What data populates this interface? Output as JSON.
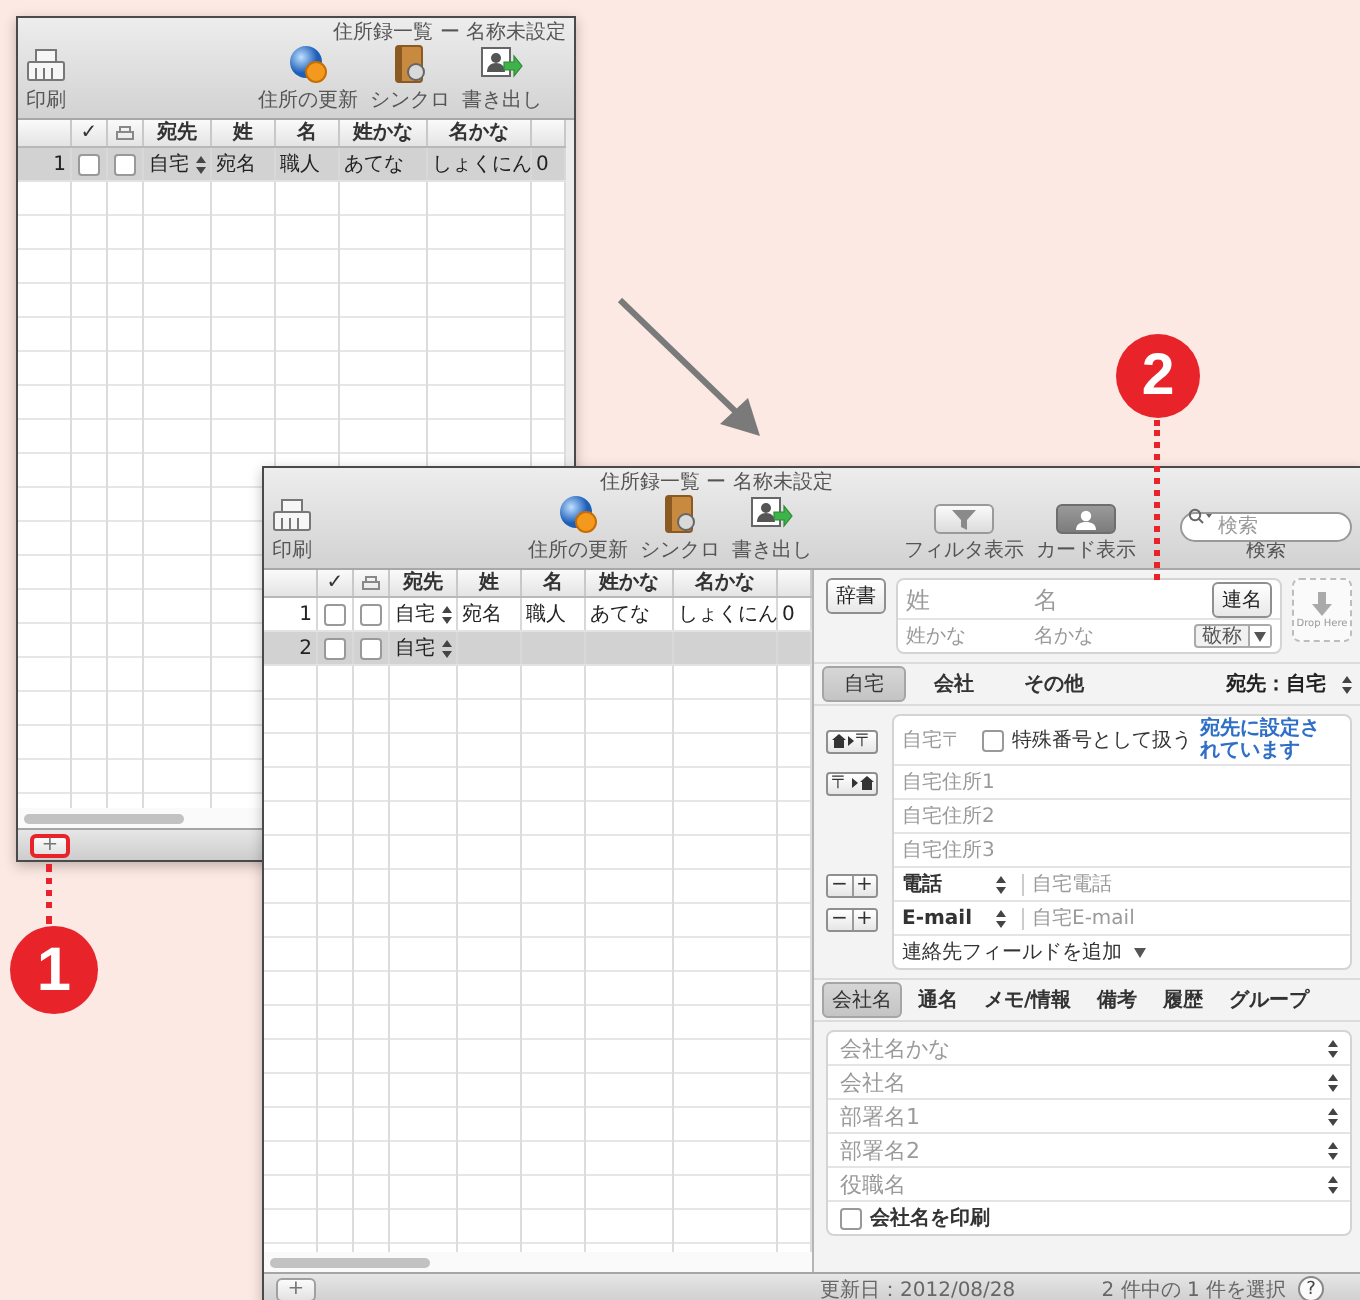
{
  "windows": [
    {
      "kind": "list_view",
      "title": "住所録一覧 ー 名称未設定",
      "toolbar": [
        {
          "kind": "print",
          "label": "印刷"
        },
        {
          "kind": "update",
          "label": "住所の更新"
        },
        {
          "kind": "sync",
          "label": "シンクロ"
        },
        {
          "kind": "export",
          "label": "書き出し"
        }
      ],
      "columns": [
        {
          "kind": "number"
        },
        {
          "kind": "check",
          "label": "✓"
        },
        {
          "kind": "print"
        },
        {
          "kind": "text",
          "label": "宛先"
        },
        {
          "kind": "text",
          "label": "姓"
        },
        {
          "kind": "text",
          "label": "名"
        },
        {
          "kind": "text",
          "label": "姓かな"
        },
        {
          "kind": "text",
          "label": "名かな"
        },
        {
          "kind": "blank"
        }
      ],
      "rows": [
        {
          "cells": [
            "1",
            "",
            "",
            "自宅",
            "宛名",
            "職人",
            "あてな",
            "しょくにん",
            "0"
          ],
          "checked": false,
          "print": false,
          "selected": true
        }
      ],
      "add_button": {
        "label": "+",
        "highlighted": true
      }
    },
    {
      "kind": "card_view",
      "title": "住所録一覧 ー 名称未設定",
      "toolbar": [
        {
          "kind": "print",
          "label": "印刷"
        },
        {
          "kind": "update",
          "label": "住所の更新"
        },
        {
          "kind": "sync",
          "label": "シンクロ"
        },
        {
          "kind": "export",
          "label": "書き出し"
        }
      ],
      "view_buttons": [
        {
          "kind": "filter",
          "label": "フィルタ表示",
          "selected": false
        },
        {
          "kind": "card",
          "label": "カード表示",
          "selected": true
        }
      ],
      "search": {
        "placeholder": "検索",
        "label": "検索"
      },
      "columns": [
        {
          "kind": "number"
        },
        {
          "kind": "check",
          "label": "✓"
        },
        {
          "kind": "print"
        },
        {
          "kind": "text",
          "label": "宛先"
        },
        {
          "kind": "text",
          "label": "姓"
        },
        {
          "kind": "text",
          "label": "名"
        },
        {
          "kind": "text",
          "label": "姓かな"
        },
        {
          "kind": "text",
          "label": "名かな"
        },
        {
          "kind": "blank"
        }
      ],
      "rows": [
        {
          "cells": [
            "1",
            "",
            "",
            "自宅",
            "宛名",
            "職人",
            "あてな",
            "しょくにん",
            "0"
          ],
          "checked": false,
          "print": false,
          "selected": false
        },
        {
          "cells": [
            "2",
            "",
            "",
            "自宅"
          ],
          "checked": false,
          "print": false,
          "selected": true
        }
      ],
      "add_button": {
        "label": "+",
        "highlighted": false
      },
      "card": {
        "dictionary_button": "辞書",
        "name_fields": [
          {
            "placeholder": "姓"
          },
          {
            "placeholder": "名"
          }
        ],
        "joint_name_button": "連名",
        "kana_fields": [
          {
            "placeholder": "姓かな"
          },
          {
            "placeholder": "名かな"
          }
        ],
        "honorific": "敬称",
        "drop_label": "Drop Here",
        "address_tabs": [
          {
            "label": "自宅",
            "selected": true
          },
          {
            "label": "会社",
            "selected": false
          },
          {
            "label": "その他",
            "selected": false
          }
        ],
        "destination": "宛先：自宅",
        "postal_buttons": [
          {
            "kind": "home_to_zip",
            "label": "〒"
          },
          {
            "kind": "zip_to_home",
            "label": "〒"
          }
        ],
        "postal": {
          "placeholder": "自宅〒"
        },
        "special_number": {
          "label": "特殊番号として扱う",
          "checked": false
        },
        "destination_link": "宛先に設定されています",
        "address_lines": [
          {
            "placeholder": "自宅住所1"
          },
          {
            "placeholder": "自宅住所2"
          },
          {
            "placeholder": "自宅住所3"
          }
        ],
        "contacts": [
          {
            "type": "電話",
            "placeholder": "自宅電話",
            "remove": "−",
            "add": "+"
          },
          {
            "type": "E-mail",
            "placeholder": "自宅E-mail",
            "remove": "−",
            "add": "+"
          }
        ],
        "add_field": "連絡先フィールドを追加",
        "company_tabs": [
          {
            "label": "会社名",
            "selected": true
          },
          {
            "label": "通名",
            "selected": false
          },
          {
            "label": "メモ/情報",
            "selected": false
          },
          {
            "label": "備考",
            "selected": false
          },
          {
            "label": "履歴",
            "selected": false
          },
          {
            "label": "グループ",
            "selected": false
          }
        ],
        "company_fields": [
          {
            "placeholder": "会社名かな"
          },
          {
            "placeholder": "会社名"
          },
          {
            "placeholder": "部署名1"
          },
          {
            "placeholder": "部署名2"
          },
          {
            "placeholder": "役職名"
          }
        ],
        "print_company": {
          "label": "会社名を印刷",
          "checked": false
        }
      },
      "status_bar": {
        "updated": "更新日：2012/08/28",
        "selection": "2 件中の 1 件を選択",
        "help": "?"
      }
    }
  ],
  "callouts": [
    {
      "number": "1"
    },
    {
      "number": "2"
    }
  ]
}
